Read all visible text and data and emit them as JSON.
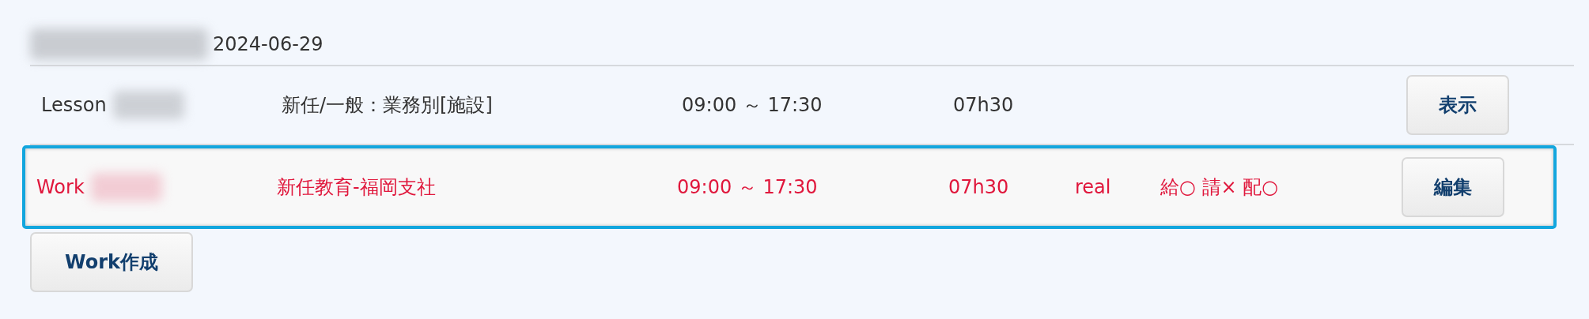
{
  "date_header": {
    "date": "2024-06-29"
  },
  "rows": [
    {
      "kind": "lesson",
      "label": "Lesson",
      "title": "新任/一般：業務別[施設]",
      "time": "09:00 ～ 17:30",
      "duration": "07h30",
      "button": "表示",
      "selected": false
    },
    {
      "kind": "work",
      "label": "Work",
      "title": "新任教育-福岡支社",
      "time": "09:00 ～ 17:30",
      "duration": "07h30",
      "mode": "real",
      "flags": "給○ 請× 配○",
      "button": "編集",
      "selected": true
    }
  ],
  "create_button": "Work作成"
}
